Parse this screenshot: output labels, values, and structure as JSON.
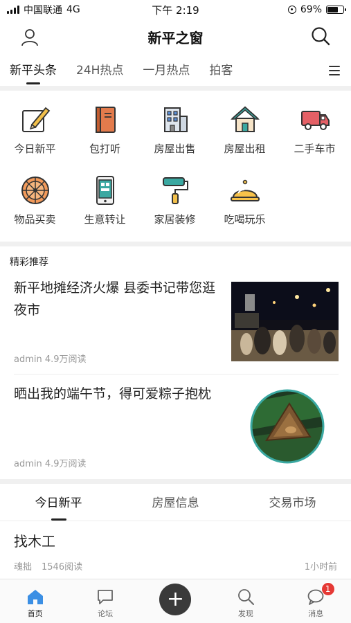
{
  "status_bar": {
    "carrier": "中国联通",
    "network": "4G",
    "time": "下午 2:19",
    "battery": "69%",
    "battery_level": 0.69
  },
  "header": {
    "title": "新平之窗",
    "user_icon": "user-icon",
    "search_icon": "search-icon"
  },
  "channel_tabs": [
    {
      "label": "新平头条",
      "active": true
    },
    {
      "label": "24H热点",
      "active": false
    },
    {
      "label": "一月热点",
      "active": false
    },
    {
      "label": "拍客",
      "active": false
    }
  ],
  "grid": [
    {
      "label": "今日新平",
      "icon": "pencil-note-icon"
    },
    {
      "label": "包打听",
      "icon": "notebook-icon"
    },
    {
      "label": "房屋出售",
      "icon": "building-icon"
    },
    {
      "label": "房屋出租",
      "icon": "house-icon"
    },
    {
      "label": "二手车市",
      "icon": "truck-icon"
    },
    {
      "label": "物品买卖",
      "icon": "wheel-icon"
    },
    {
      "label": "生意转让",
      "icon": "phone-app-icon"
    },
    {
      "label": "家居装修",
      "icon": "paint-roller-icon"
    },
    {
      "label": "吃喝玩乐",
      "icon": "food-cloche-icon"
    }
  ],
  "featured": {
    "title": "精彩推荐",
    "articles": [
      {
        "title": "新平地摊经济火爆 县委书记带您逛夜市",
        "meta": "admin 4.9万阅读"
      },
      {
        "title": "晒出我的端午节，得可爱粽子抱枕",
        "meta": "admin 4.9万阅读"
      }
    ]
  },
  "sub_tabs": [
    {
      "label": "今日新平",
      "active": true
    },
    {
      "label": "房屋信息",
      "active": false
    },
    {
      "label": "交易市场",
      "active": false
    }
  ],
  "post": {
    "title": "找木工",
    "author": "魂拙",
    "reads": "1546阅读",
    "time": "1小时前"
  },
  "tab_bar": [
    {
      "label": "首页",
      "icon": "home-icon",
      "active": true
    },
    {
      "label": "论坛",
      "icon": "forum-icon",
      "active": false
    },
    {
      "label": "",
      "icon": "add-icon",
      "active": false
    },
    {
      "label": "发现",
      "icon": "discover-search-icon",
      "active": false
    },
    {
      "label": "消息",
      "icon": "message-icon",
      "active": false,
      "badge": "1"
    }
  ],
  "colors": {
    "accent_blue": "#3b8fe4",
    "badge_red": "#e53935",
    "divider": "#f0f0f0"
  }
}
